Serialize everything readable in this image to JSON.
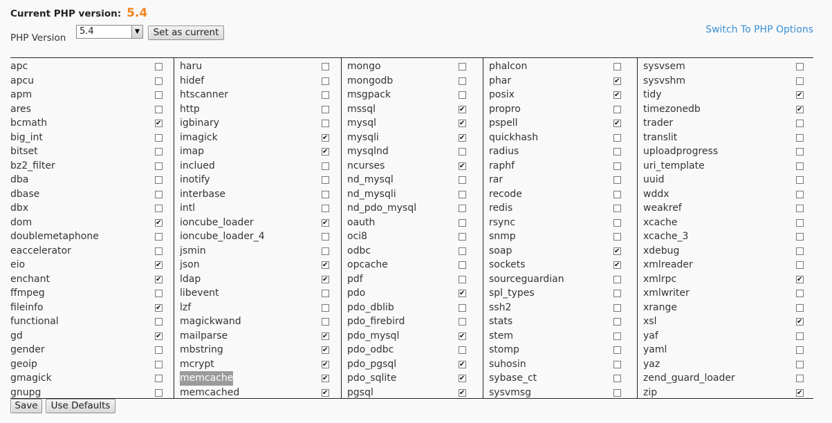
{
  "header": {
    "current_label": "Current PHP version:",
    "current_value": "5.4",
    "version_label": "PHP Version",
    "version_select": "5.4",
    "set_current_label": "Set as current",
    "switch_link": "Switch To PHP Options"
  },
  "footer": {
    "save_label": "Save",
    "defaults_label": "Use Defaults"
  },
  "colors": {
    "accent": "#f0841d",
    "link": "#3b8fd4"
  },
  "columns": [
    [
      {
        "name": "apc",
        "checked": false
      },
      {
        "name": "apcu",
        "checked": false
      },
      {
        "name": "apm",
        "checked": false
      },
      {
        "name": "ares",
        "checked": false
      },
      {
        "name": "bcmath",
        "checked": true
      },
      {
        "name": "big_int",
        "checked": false
      },
      {
        "name": "bitset",
        "checked": false
      },
      {
        "name": "bz2_filter",
        "checked": false
      },
      {
        "name": "dba",
        "checked": false
      },
      {
        "name": "dbase",
        "checked": false
      },
      {
        "name": "dbx",
        "checked": false
      },
      {
        "name": "dom",
        "checked": true
      },
      {
        "name": "doublemetaphone",
        "checked": false
      },
      {
        "name": "eaccelerator",
        "checked": false
      },
      {
        "name": "eio",
        "checked": true
      },
      {
        "name": "enchant",
        "checked": true
      },
      {
        "name": "ffmpeg",
        "checked": false
      },
      {
        "name": "fileinfo",
        "checked": true
      },
      {
        "name": "functional",
        "checked": false
      },
      {
        "name": "gd",
        "checked": true
      },
      {
        "name": "gender",
        "checked": false
      },
      {
        "name": "geoip",
        "checked": false
      },
      {
        "name": "gmagick",
        "checked": false
      },
      {
        "name": "gnupg",
        "checked": false
      }
    ],
    [
      {
        "name": "haru",
        "checked": false
      },
      {
        "name": "hidef",
        "checked": false
      },
      {
        "name": "htscanner",
        "checked": false
      },
      {
        "name": "http",
        "checked": false
      },
      {
        "name": "igbinary",
        "checked": false
      },
      {
        "name": "imagick",
        "checked": true
      },
      {
        "name": "imap",
        "checked": true
      },
      {
        "name": "inclued",
        "checked": false
      },
      {
        "name": "inotify",
        "checked": false
      },
      {
        "name": "interbase",
        "checked": false
      },
      {
        "name": "intl",
        "checked": false
      },
      {
        "name": "ioncube_loader",
        "checked": true
      },
      {
        "name": "ioncube_loader_4",
        "checked": false
      },
      {
        "name": "jsmin",
        "checked": false
      },
      {
        "name": "json",
        "checked": true
      },
      {
        "name": "ldap",
        "checked": true
      },
      {
        "name": "libevent",
        "checked": false
      },
      {
        "name": "lzf",
        "checked": false
      },
      {
        "name": "magickwand",
        "checked": false
      },
      {
        "name": "mailparse",
        "checked": true
      },
      {
        "name": "mbstring",
        "checked": true
      },
      {
        "name": "mcrypt",
        "checked": true
      },
      {
        "name": "memcache",
        "checked": true,
        "highlight": true
      },
      {
        "name": "memcached",
        "checked": true
      }
    ],
    [
      {
        "name": "mongo",
        "checked": false
      },
      {
        "name": "mongodb",
        "checked": false
      },
      {
        "name": "msgpack",
        "checked": false
      },
      {
        "name": "mssql",
        "checked": true
      },
      {
        "name": "mysql",
        "checked": true
      },
      {
        "name": "mysqli",
        "checked": true
      },
      {
        "name": "mysqlnd",
        "checked": false
      },
      {
        "name": "ncurses",
        "checked": true
      },
      {
        "name": "nd_mysql",
        "checked": false
      },
      {
        "name": "nd_mysqli",
        "checked": false
      },
      {
        "name": "nd_pdo_mysql",
        "checked": false
      },
      {
        "name": "oauth",
        "checked": false
      },
      {
        "name": "oci8",
        "checked": false
      },
      {
        "name": "odbc",
        "checked": false
      },
      {
        "name": "opcache",
        "checked": false
      },
      {
        "name": "pdf",
        "checked": false
      },
      {
        "name": "pdo",
        "checked": true
      },
      {
        "name": "pdo_dblib",
        "checked": false
      },
      {
        "name": "pdo_firebird",
        "checked": false
      },
      {
        "name": "pdo_mysql",
        "checked": true
      },
      {
        "name": "pdo_odbc",
        "checked": false
      },
      {
        "name": "pdo_pgsql",
        "checked": true
      },
      {
        "name": "pdo_sqlite",
        "checked": true
      },
      {
        "name": "pgsql",
        "checked": true
      }
    ],
    [
      {
        "name": "phalcon",
        "checked": false
      },
      {
        "name": "phar",
        "checked": true
      },
      {
        "name": "posix",
        "checked": true
      },
      {
        "name": "propro",
        "checked": false
      },
      {
        "name": "pspell",
        "checked": true
      },
      {
        "name": "quickhash",
        "checked": false
      },
      {
        "name": "radius",
        "checked": false
      },
      {
        "name": "raphf",
        "checked": false
      },
      {
        "name": "rar",
        "checked": false
      },
      {
        "name": "recode",
        "checked": false
      },
      {
        "name": "redis",
        "checked": false
      },
      {
        "name": "rsync",
        "checked": false
      },
      {
        "name": "snmp",
        "checked": false
      },
      {
        "name": "soap",
        "checked": true
      },
      {
        "name": "sockets",
        "checked": true
      },
      {
        "name": "sourceguardian",
        "checked": false
      },
      {
        "name": "spl_types",
        "checked": false
      },
      {
        "name": "ssh2",
        "checked": false
      },
      {
        "name": "stats",
        "checked": false
      },
      {
        "name": "stem",
        "checked": false
      },
      {
        "name": "stomp",
        "checked": false
      },
      {
        "name": "suhosin",
        "checked": false
      },
      {
        "name": "sybase_ct",
        "checked": false
      },
      {
        "name": "sysvmsg",
        "checked": false
      }
    ],
    [
      {
        "name": "sysvsem",
        "checked": false
      },
      {
        "name": "sysvshm",
        "checked": false
      },
      {
        "name": "tidy",
        "checked": true
      },
      {
        "name": "timezonedb",
        "checked": true
      },
      {
        "name": "trader",
        "checked": false
      },
      {
        "name": "translit",
        "checked": false
      },
      {
        "name": "uploadprogress",
        "checked": false
      },
      {
        "name": "uri_template",
        "checked": false
      },
      {
        "name": "uuid",
        "checked": false
      },
      {
        "name": "wddx",
        "checked": false
      },
      {
        "name": "weakref",
        "checked": false
      },
      {
        "name": "xcache",
        "checked": false
      },
      {
        "name": "xcache_3",
        "checked": false
      },
      {
        "name": "xdebug",
        "checked": false
      },
      {
        "name": "xmlreader",
        "checked": false
      },
      {
        "name": "xmlrpc",
        "checked": true
      },
      {
        "name": "xmlwriter",
        "checked": false
      },
      {
        "name": "xrange",
        "checked": false
      },
      {
        "name": "xsl",
        "checked": true
      },
      {
        "name": "yaf",
        "checked": false
      },
      {
        "name": "yaml",
        "checked": false
      },
      {
        "name": "yaz",
        "checked": false
      },
      {
        "name": "zend_guard_loader",
        "checked": false
      },
      {
        "name": "zip",
        "checked": true
      }
    ]
  ]
}
